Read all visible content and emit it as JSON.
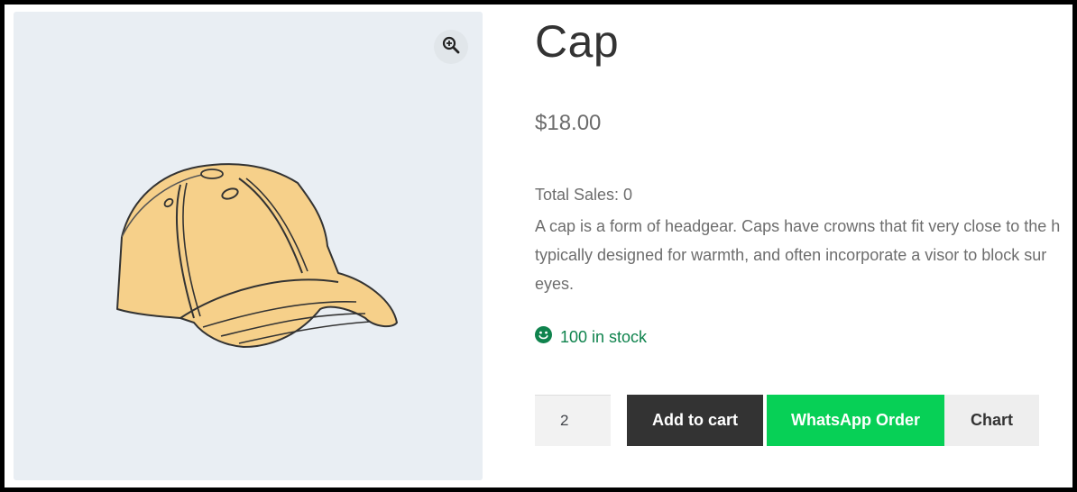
{
  "product": {
    "title": "Cap",
    "price": "$18.00",
    "total_sales": "Total Sales: 0",
    "description_lines": [
      "A cap is a form of headgear. Caps have crowns that fit very close to the h",
      "typically designed for warmth, and often incorporate a visor to block sur",
      "eyes."
    ],
    "stock": "100 in stock",
    "image_alt": "cap"
  },
  "cart": {
    "quantity": "2",
    "add_to_cart_label": "Add to cart",
    "whatsapp_label": "WhatsApp Order",
    "chart_label": "Chart"
  },
  "colors": {
    "gallery_bg": "#e9eef3",
    "add_to_cart_bg": "#333333",
    "whatsapp_bg": "#07d056",
    "chart_bg": "#eeeeee",
    "stock_color": "#0f834d"
  },
  "icons": {
    "zoom": "zoom-in-icon",
    "stock": "smiley-icon"
  }
}
